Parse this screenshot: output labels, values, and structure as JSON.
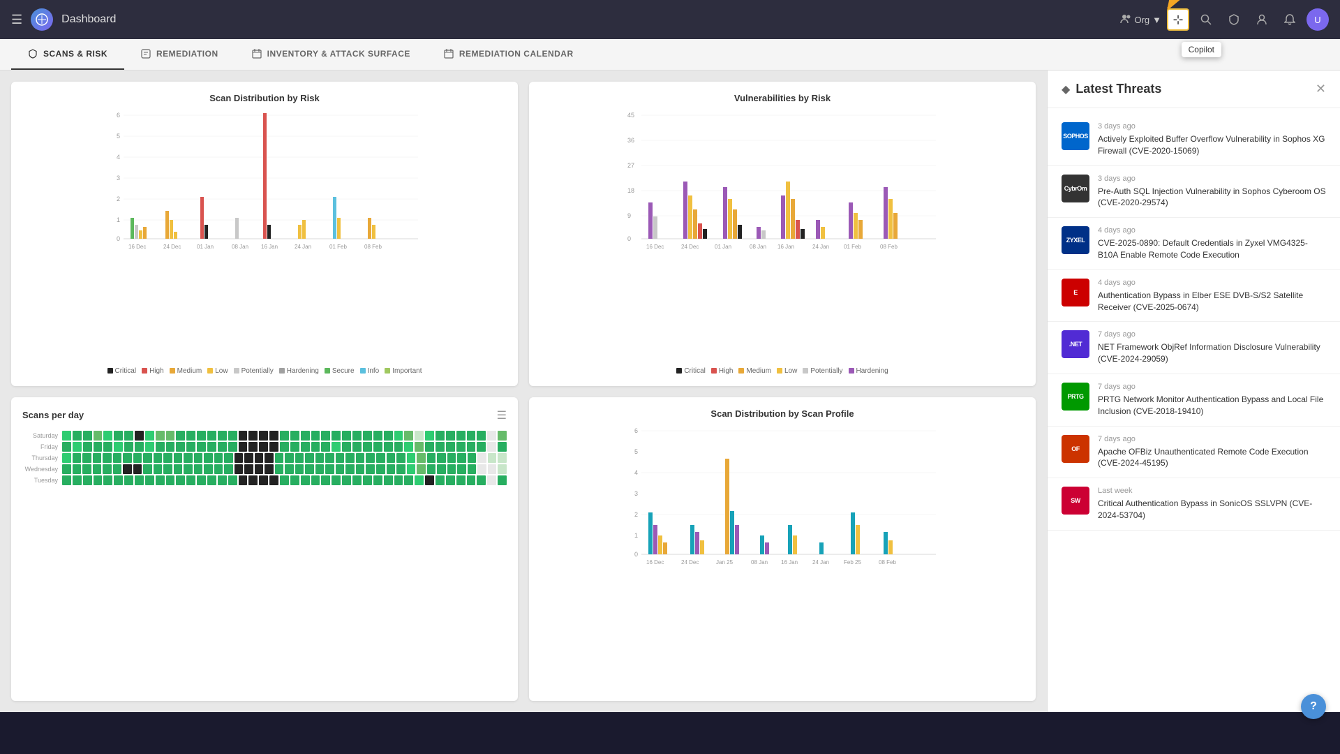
{
  "app": {
    "title": "Dashboard",
    "menu_icon": "☰",
    "org_label": "Org",
    "org_dropdown": "▼"
  },
  "header": {
    "copilot_tooltip": "Copilot",
    "buttons": [
      {
        "name": "copilot-btn",
        "icon": "⊹",
        "active": true
      },
      {
        "name": "search-btn",
        "icon": "🔍",
        "active": false
      },
      {
        "name": "shield-btn",
        "icon": "🛡",
        "active": false
      },
      {
        "name": "user-btn",
        "icon": "👤",
        "active": false
      },
      {
        "name": "bell-btn",
        "icon": "🔔",
        "active": false
      }
    ],
    "avatar_initials": "U"
  },
  "tabs": [
    {
      "id": "scans-risk",
      "label": "SCANS & RISK",
      "icon": "🛡",
      "active": true
    },
    {
      "id": "remediation",
      "label": "REMEDIATION",
      "icon": "⚙",
      "active": false
    },
    {
      "id": "inventory",
      "label": "INVENTORY & ATTACK SURFACE",
      "icon": "📅",
      "active": false
    },
    {
      "id": "remediation-calendar",
      "label": "REMEDIATION CALENDAR",
      "icon": "📅",
      "active": false
    }
  ],
  "charts": {
    "scan_distribution_risk": {
      "title": "Scan Distribution by Risk",
      "y_labels": [
        "6",
        "5",
        "4",
        "3",
        "2",
        "1",
        "0"
      ],
      "x_labels": [
        "16 Dec",
        "24 Dec",
        "01 Jan",
        "08 Jan",
        "16 Jan",
        "24 Jan",
        "01 Feb",
        "08 Feb"
      ],
      "legend": [
        {
          "label": "Critical",
          "color": "#222"
        },
        {
          "label": "High",
          "color": "#d9534f"
        },
        {
          "label": "Medium",
          "color": "#e8a838"
        },
        {
          "label": "Low",
          "color": "#f0c040"
        },
        {
          "label": "Potentially",
          "color": "#c8c8c8"
        },
        {
          "label": "Hardening",
          "color": "#a0a0a0"
        },
        {
          "label": "Secure",
          "color": "#5cb85c"
        },
        {
          "label": "Info",
          "color": "#5bc0de"
        },
        {
          "label": "Important",
          "color": "#a0c860"
        }
      ]
    },
    "vulnerabilities_risk": {
      "title": "Vulnerabilities by Risk",
      "y_labels": [
        "45",
        "36",
        "27",
        "18",
        "9",
        "0"
      ],
      "x_labels": [
        "16 Dec",
        "24 Dec",
        "01 Jan",
        "08 Jan",
        "16 Jan",
        "24 Jan",
        "01 Feb",
        "08 Feb"
      ],
      "legend": [
        {
          "label": "Critical",
          "color": "#222"
        },
        {
          "label": "High",
          "color": "#d9534f"
        },
        {
          "label": "Medium",
          "color": "#e8a838"
        },
        {
          "label": "Low",
          "color": "#f0c040"
        },
        {
          "label": "Potentially",
          "color": "#c8c8c8"
        },
        {
          "label": "Hardening",
          "color": "#9b59b6"
        }
      ]
    },
    "scans_per_day": {
      "title": "Scans per day",
      "days": [
        "Saturday",
        "Friday",
        "Thursday",
        "Wednesday",
        "Tuesday"
      ],
      "colors": [
        "#2ecc71",
        "#27ae60",
        "#1a9650",
        "#000",
        "#c8e6c9"
      ]
    },
    "scan_distribution_profile": {
      "title": "Scan Distribution by Scan Profile",
      "y_labels": [
        "6",
        "5",
        "4",
        "3",
        "2",
        "1",
        "0"
      ],
      "x_labels": [
        "16 Dec",
        "24 Dec",
        "Jan 25",
        "08 Jan",
        "16 Jan",
        "24 Jan",
        "Feb 25",
        "08 Feb"
      ]
    }
  },
  "threats": {
    "panel_title": "Latest Threats",
    "items": [
      {
        "id": 1,
        "time": "3 days ago",
        "logo_text": "SOPHOS",
        "logo_bg": "#0066cc",
        "description": "Actively Exploited Buffer Overflow Vulnerability in Sophos XG Firewall (CVE-2020-15069)"
      },
      {
        "id": 2,
        "time": "3 days ago",
        "logo_text": "CybrOm",
        "logo_bg": "#333",
        "description": "Pre-Auth SQL Injection Vulnerability in Sophos Cyberoom OS (CVE-2020-29574)"
      },
      {
        "id": 3,
        "time": "4 days ago",
        "logo_text": "ZYXEL",
        "logo_bg": "#003087",
        "description": "CVE-2025-0890: Default Credentials in Zyxel VMG4325-B10A Enable Remote Code Execution"
      },
      {
        "id": 4,
        "time": "4 days ago",
        "logo_text": "E",
        "logo_bg": "#cc0000",
        "description": "Authentication Bypass in Elber ESE DVB-S/S2 Satellite Receiver (CVE-2025-0674)"
      },
      {
        "id": 5,
        "time": "7 days ago",
        "logo_text": ".NET",
        "logo_bg": "#512bd4",
        "description": "NET Framework ObjRef Information Disclosure Vulnerability (CVE-2024-29059)"
      },
      {
        "id": 6,
        "time": "7 days ago",
        "logo_text": "PRTG",
        "logo_bg": "#009900",
        "description": "PRTG Network Monitor Authentication Bypass and Local File Inclusion (CVE-2018-19410)"
      },
      {
        "id": 7,
        "time": "7 days ago",
        "logo_text": "OF",
        "logo_bg": "#cc3300",
        "description": "Apache OFBiz Unauthenticated Remote Code Execution (CVE-2024-45195)"
      },
      {
        "id": 8,
        "time": "Last week",
        "logo_text": "SW",
        "logo_bg": "#cc0033",
        "description": "Critical Authentication Bypass in SonicOS SSLVPN (CVE-2024-53704)"
      }
    ]
  },
  "help": {
    "label": "?"
  }
}
